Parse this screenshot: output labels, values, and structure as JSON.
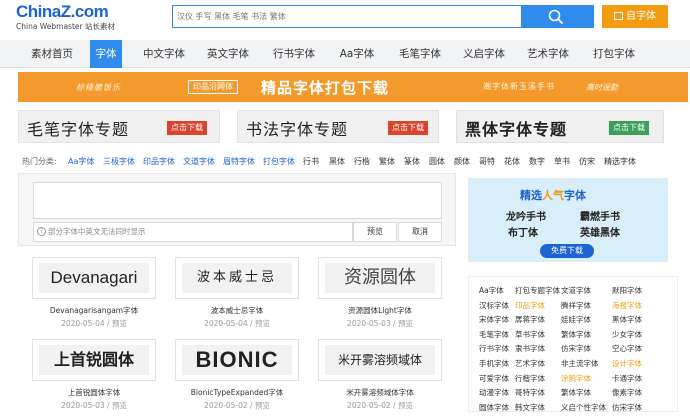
{
  "logo": {
    "main_a": "China",
    "main_b": "Z",
    "main_c": ".com",
    "sub": "China Webmaster 站长素材"
  },
  "search": {
    "placeholder": "汉仪 手写 黑体 毛笔 书法 繁体",
    "button_icon": "search-icon"
  },
  "self_button": {
    "label": "自字体"
  },
  "nav": [
    "素材首页",
    "字体",
    "中文字体",
    "英文字体",
    "行书字体",
    "Aa字体",
    "毛笔字体",
    "义启字体",
    "艺术字体",
    "打包字体"
  ],
  "nav_active": "字体",
  "banner": {
    "left_script": "标精脆饭乐",
    "badge": "印品沿网体",
    "headline": "精品字体打包下载",
    "right_script": "潮字体新玉溪手书",
    "far_right": "鹰时逞勤"
  },
  "topics": [
    {
      "title": "毛笔字体专题",
      "button": "点击下载"
    },
    {
      "title": "书法字体专题",
      "button": "点击下载"
    },
    {
      "title": "黑体字体专题",
      "button": "点击下载"
    }
  ],
  "tags": {
    "label": "热门分类:",
    "items": [
      {
        "text": "Aa字体",
        "color": "blue"
      },
      {
        "text": "三极字体",
        "color": "blue"
      },
      {
        "text": "印品字体",
        "color": "blue"
      },
      {
        "text": "文道字体",
        "color": "blue"
      },
      {
        "text": "眉特字体",
        "color": "blue"
      },
      {
        "text": "打包字体",
        "color": "blue"
      },
      {
        "text": "行书",
        "color": "dark"
      },
      {
        "text": "黑体",
        "color": "dark"
      },
      {
        "text": "行楷",
        "color": "dark"
      },
      {
        "text": "繁体",
        "color": "dark"
      },
      {
        "text": "篆体",
        "color": "dark"
      },
      {
        "text": "圆体",
        "color": "dark"
      },
      {
        "text": "颜体",
        "color": "dark"
      },
      {
        "text": "哥特",
        "color": "dark"
      },
      {
        "text": "花体",
        "color": "dark"
      },
      {
        "text": "数字",
        "color": "dark"
      },
      {
        "text": "草书",
        "color": "dark"
      },
      {
        "text": "仿宋",
        "color": "dark"
      },
      {
        "text": "精选字体",
        "color": "dark"
      }
    ]
  },
  "preview": {
    "hint": "部分字体中英文无法同时显示",
    "preview_button": "预览",
    "cancel_button": "取消"
  },
  "fonts": [
    {
      "sample": "Devanagari",
      "name": "Devanagarisangam字体",
      "date": "2020-05-04",
      "action": "预览"
    },
    {
      "sample": "波本威士忌",
      "name": "波本威士忌字体",
      "date": "2020-05-04",
      "action": "预览"
    },
    {
      "sample": "资源圆体",
      "name": "资源圆体Light字体",
      "date": "2020-05-03",
      "action": "预览"
    },
    {
      "sample": "上首锐圆体",
      "name": "上首锐圆体字体",
      "date": "2020-05-03",
      "action": "预览"
    },
    {
      "sample": "BIONIC",
      "name": "BionicTypeExpanded字体",
      "date": "2020-05-02",
      "action": "预览"
    },
    {
      "sample": "米开雾溶频域体",
      "name": "米开雾溶频域体字体",
      "date": "2020-05-02",
      "action": "预览"
    }
  ],
  "promo": {
    "heading_a": "精选",
    "heading_b": "人气",
    "heading_c": "字体",
    "fonts": [
      "龙吟手书",
      "霸燃手书",
      "布丁体",
      "英雄黑体"
    ],
    "button": "免费下载"
  },
  "side_categories": [
    [
      {
        "t": "Aa字体"
      },
      {
        "t": "打包专题字体"
      },
      {
        "t": "文道字体"
      },
      {
        "t": "默阳字体"
      }
    ],
    [
      {
        "t": "汉标字体"
      },
      {
        "t": "印品字体",
        "o": true
      },
      {
        "t": "腾祥字体"
      },
      {
        "t": "海报字体",
        "o": true
      }
    ],
    [
      {
        "t": "宋体字体"
      },
      {
        "t": "孱蒋字体"
      },
      {
        "t": "娃娃字体"
      },
      {
        "t": "黑体字体"
      }
    ],
    [
      {
        "t": "毛笔字体"
      },
      {
        "t": "草书字体"
      },
      {
        "t": "繁体字体"
      },
      {
        "t": "少女字体"
      }
    ],
    [
      {
        "t": "行书字体"
      },
      {
        "t": "隶书字体"
      },
      {
        "t": "仿宋字体"
      },
      {
        "t": "空心字体"
      }
    ],
    [
      {
        "t": "手机字体"
      },
      {
        "t": "艺术字体"
      },
      {
        "t": "非主流字体"
      },
      {
        "t": "设计字体",
        "o": true
      }
    ],
    [
      {
        "t": "可爱字体"
      },
      {
        "t": "行楷字体"
      },
      {
        "t": "涂鸦字体",
        "o": true
      },
      {
        "t": "卡通字体"
      }
    ],
    [
      {
        "t": "动漫字体"
      },
      {
        "t": "哥特字体"
      },
      {
        "t": "繁体字体"
      },
      {
        "t": "像素字体"
      }
    ],
    [
      {
        "t": "圆体字体"
      },
      {
        "t": "韩文字体"
      },
      {
        "t": "义启个性字体"
      },
      {
        "t": "仿宋字体"
      }
    ]
  ],
  "colors": {
    "accent": "#2f8bec",
    "brand": "#1e64d0",
    "orange": "#f39c12",
    "banner": "#f49a2c"
  }
}
